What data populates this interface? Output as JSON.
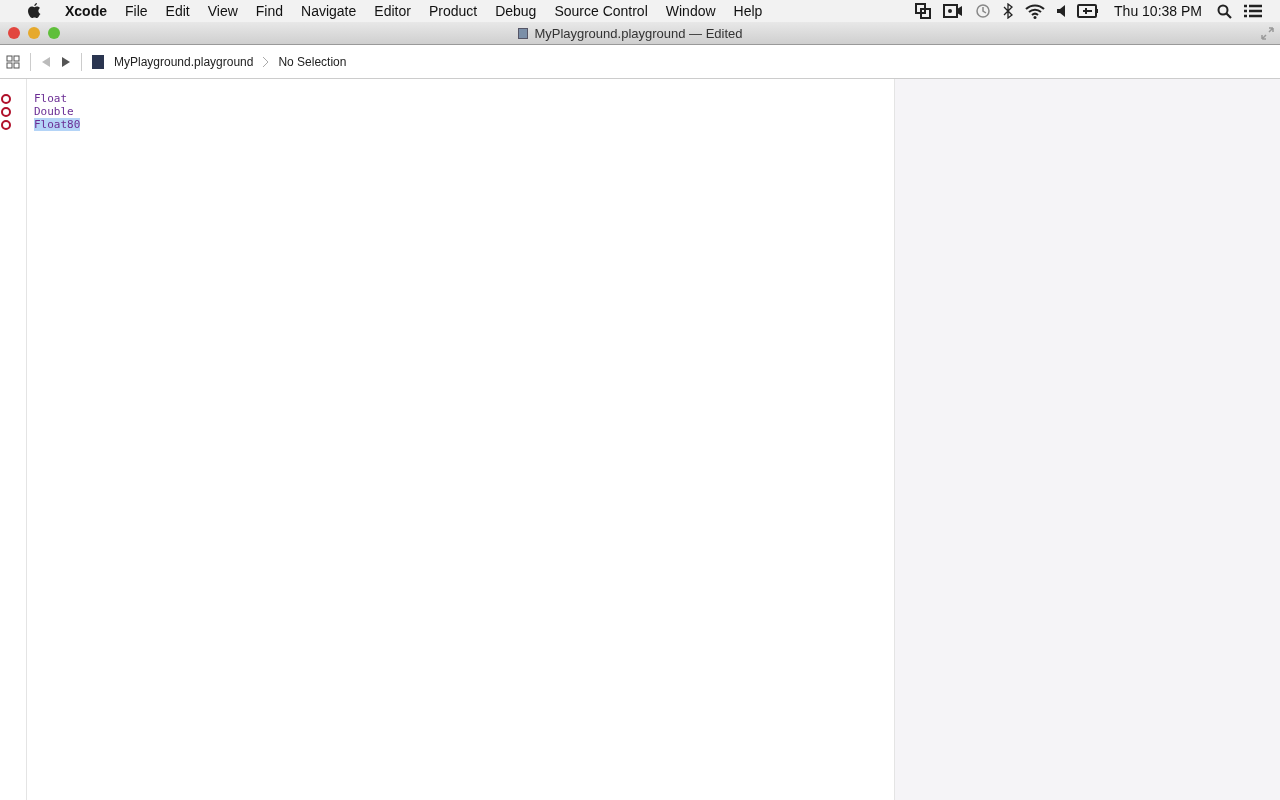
{
  "menu_bar": {
    "app": "Xcode",
    "items": [
      "File",
      "Edit",
      "View",
      "Find",
      "Navigate",
      "Editor",
      "Product",
      "Debug",
      "Source Control",
      "Window",
      "Help"
    ],
    "clock": "Thu 10:38 PM"
  },
  "window": {
    "title": "MyPlayground.playground — Edited"
  },
  "jump_bar": {
    "file": "MyPlayground.playground",
    "selection": "No Selection"
  },
  "code_lines": [
    {
      "text": "Float",
      "error": true,
      "selected": false
    },
    {
      "text": "Double",
      "error": true,
      "selected": false
    },
    {
      "text": "Float80",
      "error": true,
      "selected": true
    }
  ]
}
